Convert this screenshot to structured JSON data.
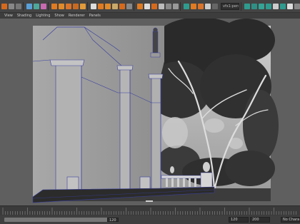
{
  "panel_menu": {
    "items": [
      "View",
      "Shading",
      "Lighting",
      "Show",
      "Renderer",
      "Panels"
    ]
  },
  "camera_selector": {
    "value": "vfx1:persp"
  },
  "range_slider": {
    "current": "120",
    "end": "120",
    "max": "200",
    "character_set": "No Character Set"
  },
  "timeline": {
    "labels": [
      "1",
      "10",
      "20",
      "30",
      "40",
      "50",
      "60",
      "70",
      "80",
      "90",
      "100",
      "110",
      "120"
    ]
  },
  "colors": {
    "ui_dark": "#444444",
    "panel_grey": "#3d3d3d",
    "accent_orange": "#e07b22",
    "accent_teal": "#2f9b8f",
    "wireframe": "#3a3fa0"
  }
}
